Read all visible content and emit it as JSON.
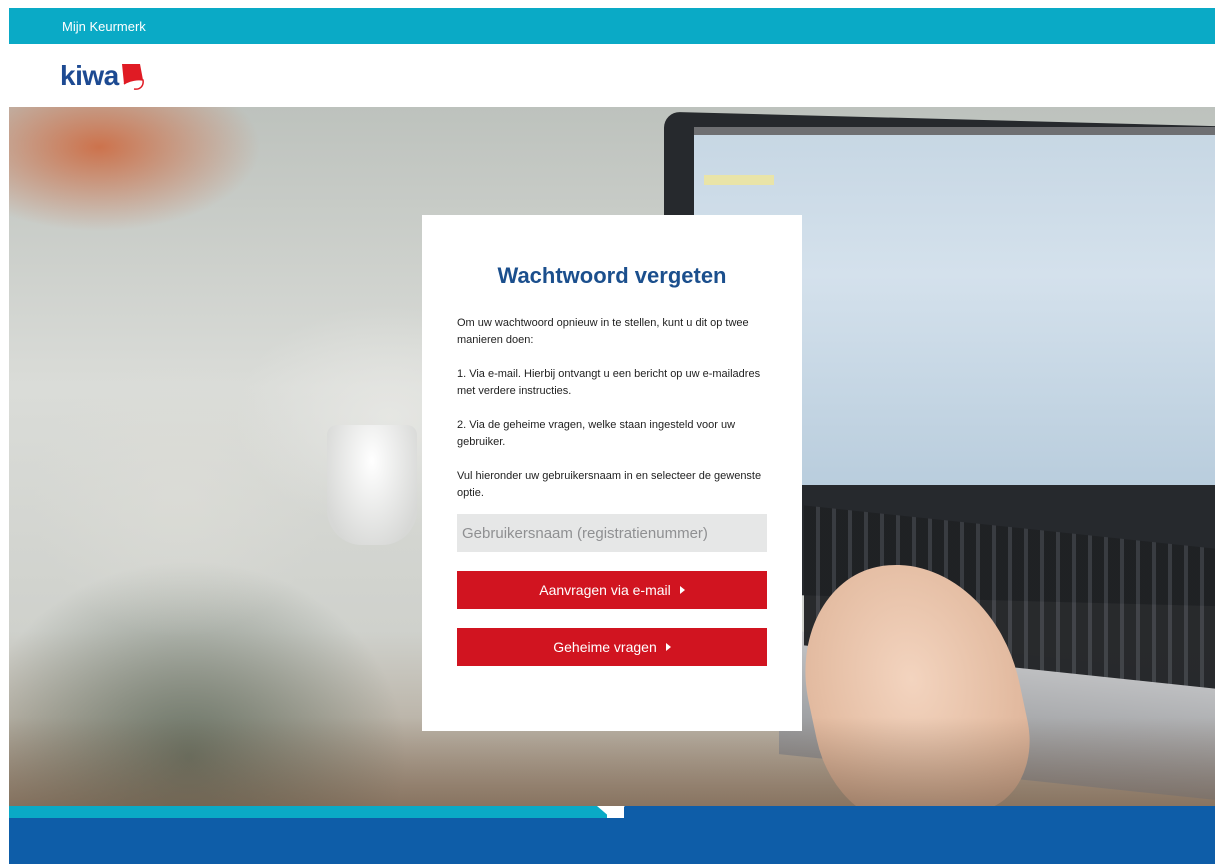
{
  "header": {
    "title": "Mijn Keurmerk"
  },
  "logo": {
    "text": "kiwa"
  },
  "colors": {
    "top_bar": "#0aaac6",
    "title": "#1b4f8d",
    "button": "#d11420",
    "footer": "#0e5da8"
  },
  "modal": {
    "title": "Wachtwoord vergeten",
    "paragraphs": [
      "Om uw wachtwoord opnieuw in te stellen, kunt u dit op twee manieren doen:",
      "1. Via e-mail. Hierbij ontvangt u een bericht op uw e-mailadres met verdere instructies.",
      "2. Via de geheime vragen, welke staan ingesteld voor uw gebruiker.",
      "Vul hieronder uw gebruikersnaam in en selecteer de gewenste optie."
    ],
    "username": {
      "value": "",
      "placeholder": "Gebruikersnaam (registratienummer)"
    },
    "buttons": {
      "email": "Aanvragen via e-mail",
      "questions": "Geheime vragen"
    },
    "icons": {
      "button_arrow": "caret-right-icon"
    }
  }
}
